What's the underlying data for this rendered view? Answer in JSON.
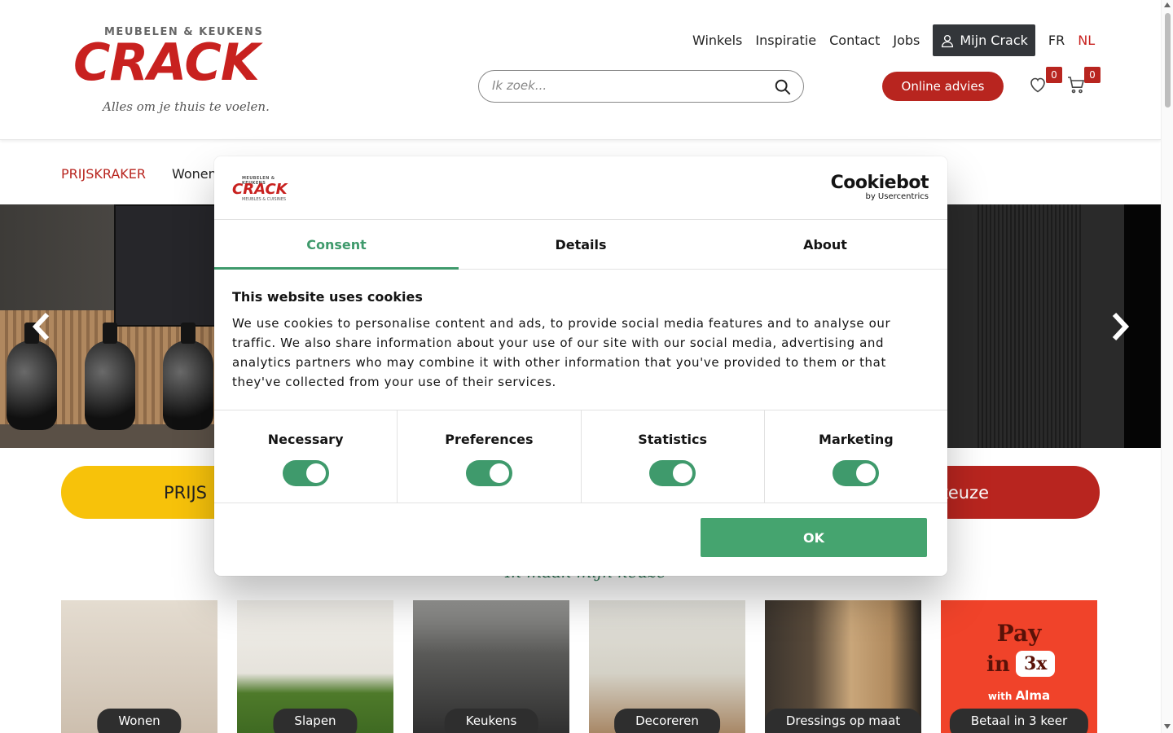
{
  "logo": {
    "tagline_top": "MEUBELEN & KEUKENS",
    "brand": "CRACK",
    "tagline_bottom": "Alles om je thuis te voelen."
  },
  "topnav": {
    "links": [
      "Winkels",
      "Inspiratie",
      "Contact",
      "Jobs"
    ],
    "account_label": "Mijn Crack",
    "languages": [
      "FR",
      "NL"
    ],
    "active_language": "NL"
  },
  "search": {
    "placeholder": "Ik zoek..."
  },
  "online_advies_label": "Online advies",
  "wishlist_count": "0",
  "cart_count": "0",
  "category_nav": {
    "items": [
      "PRIJSKRAKER",
      "Wonen"
    ]
  },
  "promo_pills": {
    "yellow_label": "PRIJS",
    "red_label": "keuze"
  },
  "handwritten_text": "Ik maak mijn keuze",
  "tiles": [
    {
      "label": "Wonen"
    },
    {
      "label": "Slapen"
    },
    {
      "label": "Keukens"
    },
    {
      "label": "Decoreren"
    },
    {
      "label": "Dressings op maat"
    },
    {
      "label": "Betaal in 3 keer",
      "pay_line": "Pay",
      "in_line": "in",
      "times": "3x",
      "with": "with",
      "provider": "Alma"
    }
  ],
  "cookie_modal": {
    "brand_logo": {
      "top": "MEUBELEN & KEUKENS",
      "brand": "CRACK",
      "bottom": "MEUBLES & CUISINES"
    },
    "cookiebot_name": "Cookiebot",
    "cookiebot_by": "by Usercentrics",
    "tabs": [
      "Consent",
      "Details",
      "About"
    ],
    "active_tab": "Consent",
    "title": "This website uses cookies",
    "body": "We use cookies to personalise content and ads, to provide social media features and to analyse our traffic. We also share information about your use of our site with our social media, advertising and analytics partners who may combine it with other information that you've provided to them or that they've collected from your use of their services.",
    "toggles": [
      {
        "label": "Necessary",
        "on": true
      },
      {
        "label": "Preferences",
        "on": true
      },
      {
        "label": "Statistics",
        "on": true
      },
      {
        "label": "Marketing",
        "on": true
      }
    ],
    "ok_label": "OK",
    "accent_color": "#3f9a6c"
  },
  "colors": {
    "brand_red": "#c8211f",
    "button_red": "#b8251f",
    "yellow": "#f7c20a",
    "dark_button": "#33363a"
  }
}
